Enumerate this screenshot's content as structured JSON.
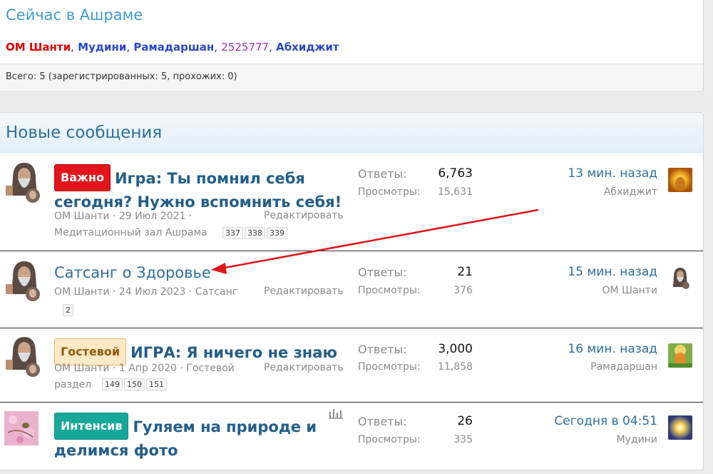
{
  "online": {
    "title": "Сейчас в Ашраме",
    "users": [
      {
        "name": "ОМ Шанти",
        "color": "#e00000"
      },
      {
        "name": "Мудини",
        "color": "#2a47c8"
      },
      {
        "name": "Рамадаршан",
        "color": "#2a47c8"
      },
      {
        "name": "2525777",
        "color": "#a033c0"
      },
      {
        "name": "Абхиджит",
        "color": "#2a47c8"
      }
    ],
    "separator": ",",
    "total": "Всего: 5 (зарегистрированных: 5, прохожих: 0)"
  },
  "threads": {
    "header": "Новые сообщения",
    "replies_label": "Ответы:",
    "views_label": "Просмотры:",
    "edit_label": "Редактировать",
    "items": [
      {
        "badge": "Важно",
        "title_line1": "Игра: Ты помнил себя",
        "title_line2": "сегодня? Нужно вспомнить себя!",
        "author": "ОМ Шанти",
        "date": "29 Июл 2021",
        "forum": "Медитационный зал Ашрама",
        "pages": [
          "337",
          "338",
          "339"
        ],
        "replies": "6,763",
        "views": "15,631",
        "last_time": "13 мин. назад",
        "last_user": "Абхиджит"
      },
      {
        "title": "Сатсанг о Здоровье",
        "author": "ОМ Шанти",
        "date": "24 Июл 2023",
        "forum": "Сатсанг",
        "pages": [
          "2"
        ],
        "replies": "21",
        "views": "376",
        "last_time": "15 мин. назад",
        "last_user": "ОМ Шанти"
      },
      {
        "badge": "Гостевой",
        "title": "ИГРА: Я ничего не знаю",
        "author": "ОМ Шанти",
        "date": "1 Апр 2020",
        "forum_line1": "Гостевой",
        "forum_line2": "раздел",
        "pages": [
          "149",
          "150",
          "151"
        ],
        "replies": "3,000",
        "views": "11,858",
        "last_time": "16 мин. назад",
        "last_user": "Рамадаршан"
      },
      {
        "badge": "Интенсив",
        "title_line1": "Гуляем на природе и",
        "title_line2": "делимся фото",
        "replies": "26",
        "views": "335",
        "last_time": "Сегодня в 04:51",
        "last_user": "Мудини"
      }
    ]
  },
  "annotation": {
    "arrow_color": "#e0141a"
  }
}
